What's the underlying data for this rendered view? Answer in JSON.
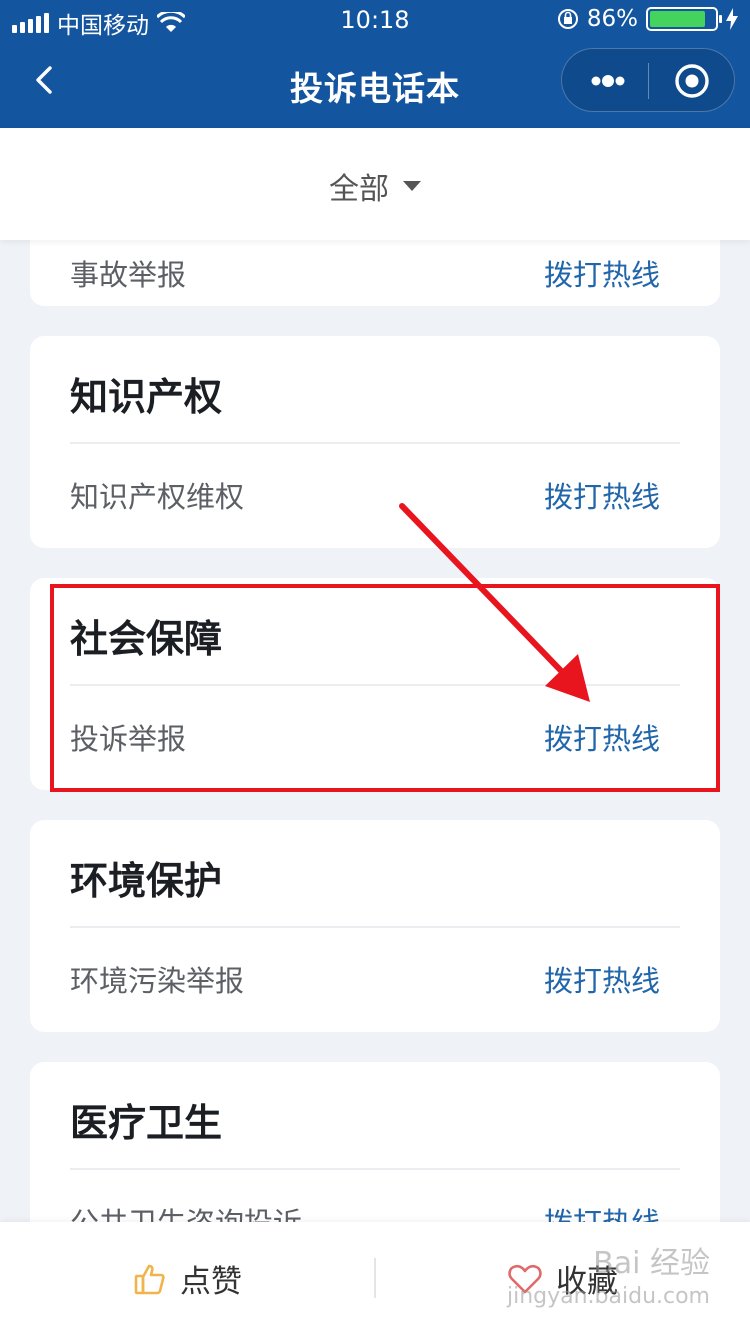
{
  "status": {
    "carrier": "中国移动",
    "time": "10:18",
    "battery": "86%",
    "battery_level": 0.86
  },
  "nav": {
    "title": "投诉电话本"
  },
  "filter": {
    "label": "全部"
  },
  "cards": [
    {
      "title": "",
      "item": "事故举报",
      "action": "拨打热线"
    },
    {
      "title": "知识产权",
      "item": "知识产权维权",
      "action": "拨打热线"
    },
    {
      "title": "社会保障",
      "item": "投诉举报",
      "action": "拨打热线"
    },
    {
      "title": "环境保护",
      "item": "环境污染举报",
      "action": "拨打热线"
    },
    {
      "title": "医疗卫生",
      "item": "公共卫生咨询投诉",
      "action": "拨打热线"
    }
  ],
  "bottom": {
    "like_label": "点赞",
    "favorite_label": "收藏"
  },
  "watermark": {
    "line1": "Bai 经验",
    "line2": "jingyan.baidu.com"
  },
  "colors": {
    "nav_bg": "#1455a0",
    "link": "#2266aa",
    "highlight": "#e8141e",
    "like_icon": "#f0b44a",
    "favorite_icon": "#e06a6a"
  }
}
